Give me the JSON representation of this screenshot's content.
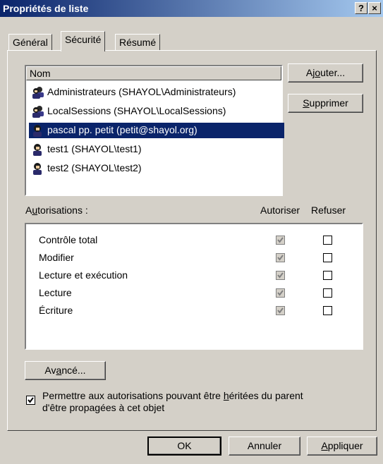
{
  "window": {
    "title": "Propriétés de liste",
    "help_label": "?",
    "close_label": "×"
  },
  "tabs": [
    {
      "label": "Général"
    },
    {
      "label": "Sécurité"
    },
    {
      "label": "Résumé"
    }
  ],
  "users_list": {
    "header": "Nom",
    "items": [
      {
        "label": "Administrateurs (SHAYOL\\Administrateurs)",
        "kind": "group"
      },
      {
        "label": "LocalSessions (SHAYOL\\LocalSessions)",
        "kind": "group"
      },
      {
        "label": "pascal pp. petit (petit@shayol.org)",
        "kind": "user",
        "selected": true
      },
      {
        "label": "test1 (SHAYOL\\test1)",
        "kind": "user"
      },
      {
        "label": "test2 (SHAYOL\\test2)",
        "kind": "user"
      }
    ]
  },
  "buttons": {
    "add_pre": "Aj",
    "add_key": "o",
    "add_post": "uter...",
    "remove_key": "S",
    "remove_post": "upprimer",
    "advanced_pre": "Av",
    "advanced_key": "a",
    "advanced_post": "ncé...",
    "ok": "OK",
    "cancel": "Annuler",
    "apply_key": "A",
    "apply_post": "ppliquer"
  },
  "permissions": {
    "label_pre": "A",
    "label_key": "u",
    "label_post": "torisations :",
    "allow_header": "Autoriser",
    "deny_header": "Refuser",
    "rows": [
      {
        "name": "Contrôle total",
        "allow": true,
        "deny": false
      },
      {
        "name": "Modifier",
        "allow": true,
        "deny": false
      },
      {
        "name": "Lecture et exécution",
        "allow": true,
        "deny": false
      },
      {
        "name": "Lecture",
        "allow": true,
        "deny": false
      },
      {
        "name": "Écriture",
        "allow": true,
        "deny": false
      }
    ]
  },
  "inherit": {
    "line1_pre": "Permettre aux autorisations pouvant être ",
    "line1_key": "h",
    "line1_post": "éritées du parent",
    "line2": "d'être propagées à cet objet",
    "checked": true
  },
  "colors": {
    "title_start": "#0a246a",
    "title_end": "#a6caf0",
    "selection": "#0a246a",
    "face": "#d4d0c8"
  }
}
